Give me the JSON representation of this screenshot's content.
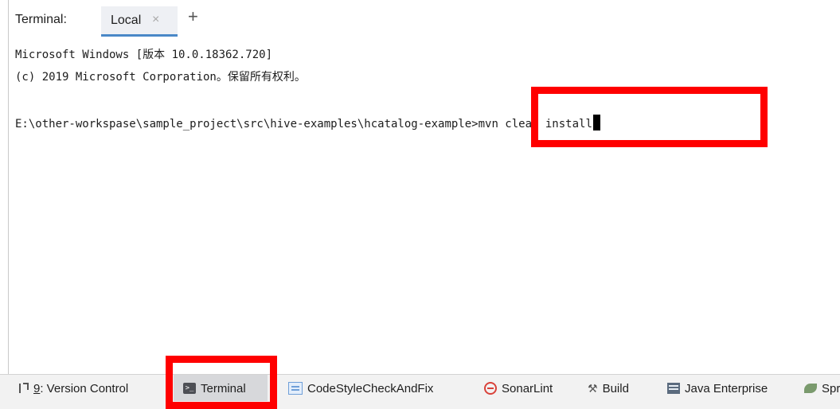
{
  "terminal": {
    "title": "Terminal:",
    "tab_label": "Local",
    "tab_close": "×",
    "add_tab": "+"
  },
  "console": {
    "line1": "Microsoft Windows [版本 10.0.18362.720]",
    "line2": "(c) 2019 Microsoft Corporation。保留所有权利。",
    "prompt": "E:\\other-workspase\\sample_project\\src\\hive-examples\\hcatalog-example>",
    "command": "mvn clean install"
  },
  "toolbar": {
    "version_control_key": "9",
    "version_control_label": ": Version Control",
    "terminal_label": "Terminal",
    "codestyle_label": "CodeStyleCheckAndFix",
    "sonarlint_label": "SonarLint",
    "build_label": "Build",
    "java_enterprise_label": "Java Enterprise",
    "spring_label": "Spr"
  },
  "icons": {
    "version_control": "version-control-icon",
    "terminal": "terminal-icon",
    "codestyle": "codestyle-icon",
    "sonarlint": "sonarlint-icon",
    "build": "hammer-icon",
    "java_enterprise": "java-enterprise-icon",
    "spring": "spring-leaf-icon"
  },
  "colors": {
    "highlight_box": "#ff0000",
    "tab_underline": "#4a88c7",
    "active_tool_bg": "#d7d8db"
  }
}
